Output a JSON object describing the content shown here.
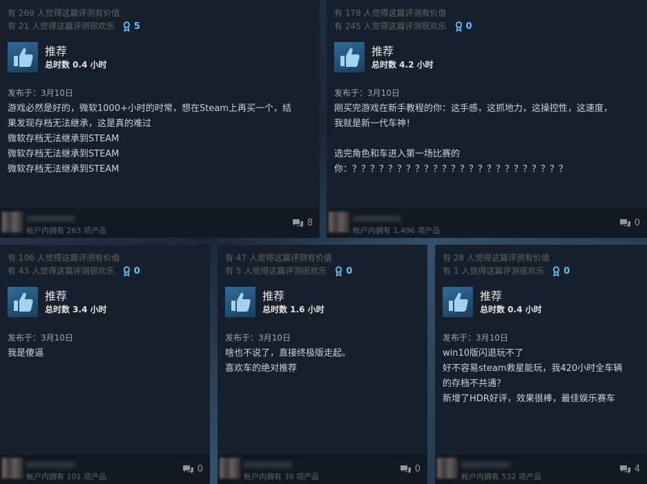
{
  "reviews": [
    {
      "helpful": "有 269 人觉得这篇评测有价值",
      "funny": "有 21 人觉得这篇评测很欢乐",
      "awards": "5",
      "verdict": "推荐",
      "hours": "总时数 0.4 小时",
      "posted": "发布于：3月10日",
      "lines": [
        "游戏必然是好的，微软1000+小时的时常，想在Steam上再买一个，结",
        "果发现存档无法继承，这是真的难过",
        "微软存档无法继承到STEAM",
        "微软存档无法继承到STEAM",
        "微软存档无法继承到STEAM"
      ],
      "owned": "帐户内拥有 263 项产品",
      "comments": "8"
    },
    {
      "helpful": "有 178 人觉得这篇评测有价值",
      "funny": "有 245 人觉得这篇评测很欢乐",
      "awards": "0",
      "verdict": "推荐",
      "hours": "总时数 4.2 小时",
      "posted": "发布于：3月10日",
      "lines": [
        "刚买完游戏在新手教程的你：这手感，这抓地力，这操控性，这速度，",
        "我就是新一代车神！",
        "",
        "选完角色和车进入第一场比赛的",
        "你：？？？？？？？？？？？？？？？？？？？？？？？？"
      ],
      "owned": "帐户内拥有 1,496 项产品",
      "comments": "0"
    },
    {
      "helpful": "有 106 人觉得这篇评测有价值",
      "funny": "有 43 人觉得这篇评测很欢乐",
      "awards": "0",
      "verdict": "推荐",
      "hours": "总时数 3.4 小时",
      "posted": "发布于：3月10日",
      "lines": [
        "我是傻逼"
      ],
      "owned": "帐户内拥有 101 项产品",
      "comments": "0"
    },
    {
      "helpful": "有 47 人觉得这篇评测有价值",
      "funny": "有 5 人觉得这篇评测很欢乐",
      "awards": "0",
      "verdict": "推荐",
      "hours": "总时数 1.6 小时",
      "posted": "发布于：3月10日",
      "lines": [
        "啥也不说了，直接终极版走起。",
        "喜欢车的绝对推荐"
      ],
      "owned": "帐户内拥有 39 项产品",
      "comments": "0"
    },
    {
      "helpful": "有 28 人觉得这篇评测有价值",
      "funny": "有 1 人觉得这篇评测很欢乐",
      "awards": "0",
      "verdict": "推荐",
      "hours": "总时数 0.4 小时",
      "posted": "发布于：3月10日",
      "lines": [
        "win10版闪退玩不了",
        "好不容易steam救星能玩，我420小时全车辆",
        "的存档不共通？",
        "新增了HDR好评，效果很棒，最佳娱乐赛车"
      ],
      "owned": "帐户内拥有 532 项产品",
      "comments": "4"
    }
  ],
  "icons": {
    "thumb": "thumbs-up-icon",
    "award": "award-icon",
    "comment": "comment-icon"
  },
  "colors": {
    "accent": "#66c0f4",
    "card_bg": "#16202d"
  }
}
